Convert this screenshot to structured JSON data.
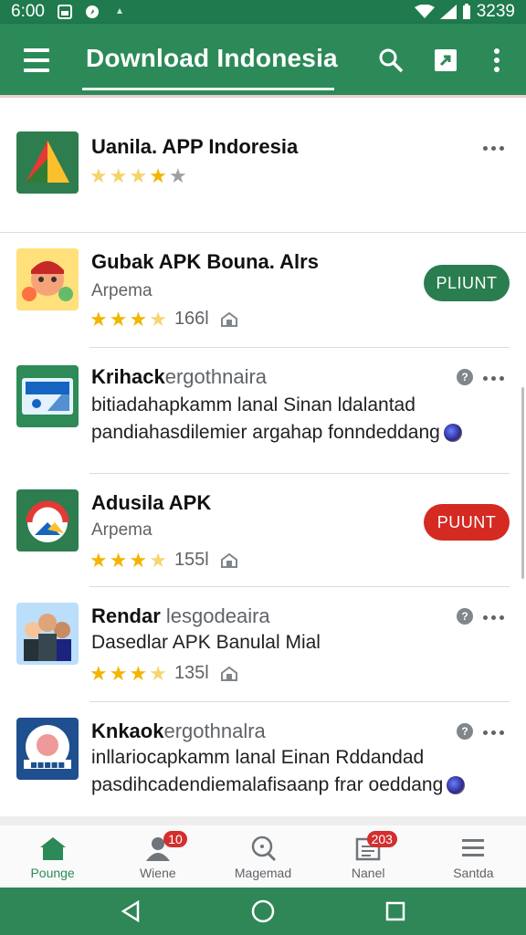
{
  "status_bar": {
    "time": "6:00",
    "clock_right": "3239"
  },
  "app_bar": {
    "title": "Download Indonesia",
    "icons": [
      "menu-icon",
      "search-icon",
      "share-icon",
      "more-vert-icon"
    ]
  },
  "apps": [
    {
      "name": "Uanila. APP Indoresia",
      "rating": 3.5
    },
    {
      "name": "Gubak APK Bouna. Alrs",
      "publisher": "Arpema",
      "rating": 3.5,
      "count": "166l",
      "button": "PLIUNT",
      "button_color": "#2a7d4f"
    },
    {
      "name_bold": "Krihack",
      "name_sub": "ergothnaira",
      "desc1": "bitiadahapkamm lanal Sinan ldalantad",
      "desc2": "pandiahasdilemier argahap fonndeddang"
    },
    {
      "name": "Adusila APK",
      "publisher": "Arpema",
      "rating": 3.5,
      "count": "155l",
      "button": "PUUNT",
      "button_color": "#d42a22"
    },
    {
      "name_bold": "Rendar",
      "name_sub": "lesgodeaira",
      "desc1": "Dasedlar APK Banulal Mial",
      "rating": 3.5,
      "count": "135l"
    },
    {
      "name_bold": "Knkaok",
      "name_sub": "ergothnalra",
      "desc1": "inllariocapkamm lanal Einan Rddandad",
      "desc2": "pasdihcadendiemalafisaanp frar oeddang"
    }
  ],
  "bottom_nav": [
    {
      "label": "Pounge",
      "icon": "home-icon",
      "active": true
    },
    {
      "label": "Wiene",
      "icon": "person-icon",
      "badge": "10"
    },
    {
      "label": "Magemad",
      "icon": "search-icon"
    },
    {
      "label": "Nanel",
      "icon": "news-icon",
      "badge": "203"
    },
    {
      "label": "Santda",
      "icon": "menu-icon"
    }
  ],
  "colors": {
    "primary": "#2c8a58",
    "status_bar": "#1f7a4d",
    "accent_red": "#d42a22",
    "star": "#f4b400"
  }
}
